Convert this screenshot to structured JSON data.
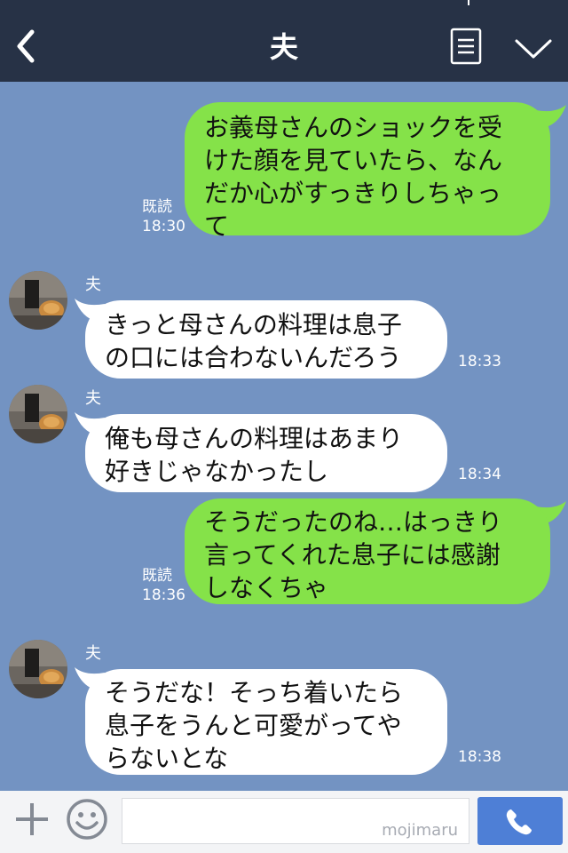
{
  "header": {
    "title": "夫"
  },
  "messages": [
    {
      "side": "out",
      "text": "お義母さんのショックを受けた顔を見ていたら、なんだか心がすっきりしちゃって",
      "lines": [
        "お義母さんのショックを受",
        "けた顔を見ていたら、なん",
        "だか心がすっきりしちゃっ",
        "て"
      ],
      "read": "既読",
      "time": "18:30"
    },
    {
      "side": "in",
      "name": "夫",
      "text": "きっと母さんの料理は息子の口には合わないんだろう",
      "lines": [
        "きっと母さんの料理は息子",
        "の口には合わないんだろう"
      ],
      "time": "18:33"
    },
    {
      "side": "in",
      "name": "夫",
      "text": "俺も母さんの料理はあまり好きじゃなかったし",
      "lines": [
        "俺も母さんの料理はあまり",
        "好きじゃなかったし"
      ],
      "time": "18:34"
    },
    {
      "side": "out",
      "text": "そうだったのね…はっきり言ってくれた息子には感謝しなくちゃ",
      "lines": [
        "そうだったのね…はっきり",
        "言ってくれた息子には感謝",
        "しなくちゃ"
      ],
      "read": "既読",
      "time": "18:36"
    },
    {
      "side": "in",
      "name": "夫",
      "text": "そうだな！そっち着いたら息子をうんと可愛がってやらないとな",
      "lines": [
        "そうだな！そっち着いたら",
        "息子をうんと可愛がってや",
        "らないとな"
      ],
      "time": "18:38"
    }
  ],
  "input": {
    "value": "",
    "watermark": "mojimaru"
  },
  "icons": {
    "back": "back-chevron-icon",
    "menu": "menu-icon",
    "collapse": "chevron-down-icon",
    "plus": "plus-icon",
    "emoji": "emoji-icon",
    "call": "phone-icon"
  },
  "colors": {
    "background": "#7393c2",
    "header": "#273246",
    "outgoing_bubble": "#85e249",
    "incoming_bubble": "#ffffff",
    "call_button": "#4e7fd6"
  }
}
